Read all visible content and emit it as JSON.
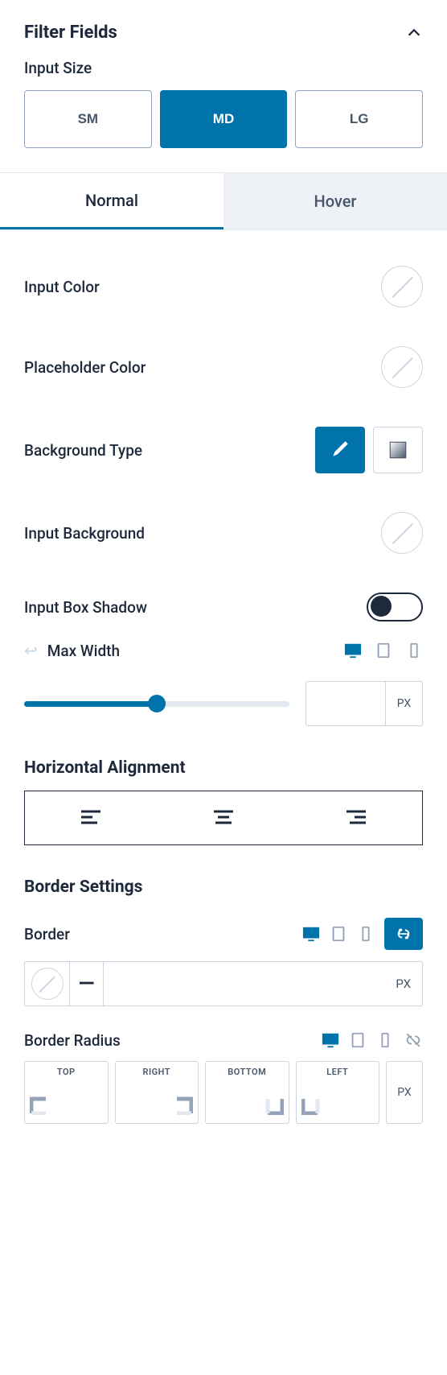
{
  "section_title": "Filter Fields",
  "input_size": {
    "label": "Input Size",
    "options": [
      "SM",
      "MD",
      "LG"
    ],
    "selected": "MD"
  },
  "tabs": {
    "normal": "Normal",
    "hover": "Hover",
    "active": "Normal"
  },
  "controls": {
    "input_color": "Input Color",
    "placeholder_color": "Placeholder Color",
    "background_type": "Background Type",
    "input_background": "Input Background",
    "input_box_shadow": "Input Box Shadow",
    "max_width": "Max Width",
    "max_width_unit": "PX",
    "horizontal_alignment": "Horizontal Alignment",
    "border_settings": "Border Settings",
    "border": "Border",
    "border_unit": "PX",
    "border_radius": "Border Radius",
    "radius_sides": [
      "TOP",
      "RIGHT",
      "BOTTOM",
      "LEFT"
    ],
    "radius_unit": "PX"
  },
  "slider": {
    "percent": 50
  }
}
